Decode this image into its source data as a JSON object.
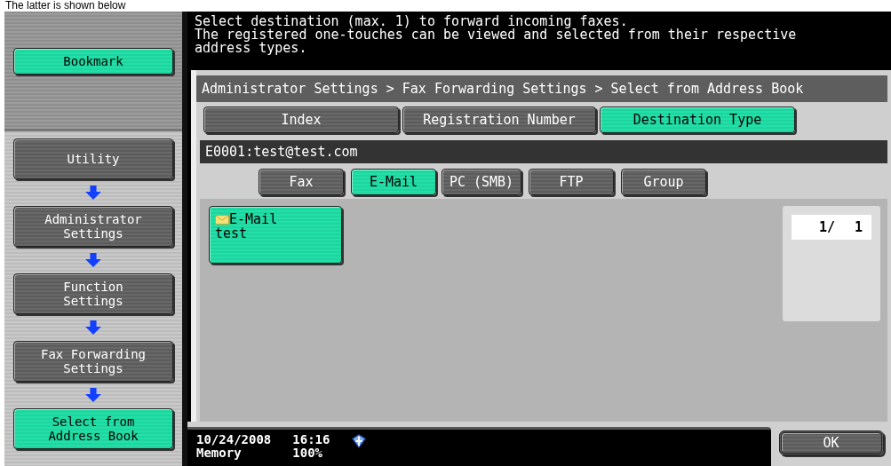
{
  "caption": "The latter is shown below",
  "sidebar": {
    "bookmark": {
      "label": "Bookmark"
    },
    "steps": [
      {
        "label": "Utility",
        "selected": false
      },
      {
        "label": "Administrator\nSettings",
        "selected": false
      },
      {
        "label": "Function\nSettings",
        "selected": false
      },
      {
        "label": "Fax Forwarding\nSettings",
        "selected": false
      },
      {
        "label": "Select from\nAddress Book",
        "selected": true
      }
    ]
  },
  "message": "Select destination (max. 1) to forward incoming faxes.\nThe registered one-touches can be viewed and selected from their respective\naddress types.",
  "breadcrumb": "Administrator Settings > Fax Forwarding Settings > Select from Address Book",
  "tabs": [
    {
      "label": "Index",
      "selected": false
    },
    {
      "label": "Registration Number",
      "selected": false
    },
    {
      "label": "Destination Type",
      "selected": true
    }
  ],
  "selection": "E0001:test@test.com",
  "type_filters": [
    {
      "label": "Fax",
      "selected": false
    },
    {
      "label": "E-Mail",
      "selected": true
    },
    {
      "label": "PC (SMB)",
      "selected": false
    },
    {
      "label": "FTP",
      "selected": false
    },
    {
      "label": "Group",
      "selected": false
    }
  ],
  "destinations": [
    {
      "type": "E-Mail",
      "name": "test",
      "selected": true
    }
  ],
  "page_counter": {
    "current": "1/",
    "total": "1"
  },
  "status_bar": {
    "date": "10/24/2008",
    "time": "16:16",
    "memory_label": "Memory",
    "memory_value": "100%"
  },
  "ok_button": "OK"
}
